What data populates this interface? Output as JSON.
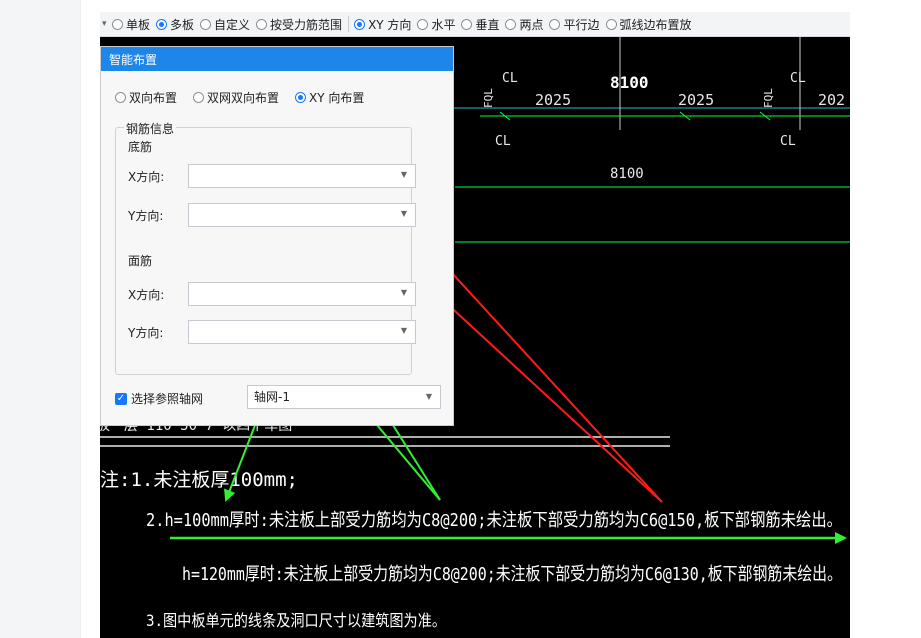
{
  "toolbar": {
    "options": [
      {
        "label": "单板",
        "checked": false
      },
      {
        "label": "多板",
        "checked": true
      },
      {
        "label": "自定义",
        "checked": false
      },
      {
        "label": "按受力筋范围",
        "checked": false
      },
      {
        "label": "XY 方向",
        "checked": true
      },
      {
        "label": "水平",
        "checked": false
      },
      {
        "label": "垂直",
        "checked": false
      },
      {
        "label": "两点",
        "checked": false
      },
      {
        "label": "平行边",
        "checked": false
      },
      {
        "label": "弧线边布置放",
        "checked": false
      }
    ]
  },
  "dialog": {
    "title": "智能布置",
    "modes": [
      {
        "label": "双向布置",
        "checked": false
      },
      {
        "label": "双网双向布置",
        "checked": false
      },
      {
        "label": "XY 向布置",
        "checked": true
      }
    ],
    "group_label": "钢筋信息",
    "bottom_label": "底筋",
    "top_label": "面筋",
    "x_label": "X方向:",
    "y_label": "Y方向:",
    "ref_checkbox_label": "选择参照轴网",
    "ref_checked": true,
    "ref_value": "轴网-1"
  },
  "cad": {
    "dim_8100": "8100",
    "dim_2025a": "2025",
    "dim_2025b": "2025",
    "dim_2025c": "202",
    "cl": "CL",
    "fql": "FQL",
    "notes_line1": "注:1.未注板厚100mm;",
    "notes_line2": "2.h=100mm厚时:未注板上部受力筋均为C8@200;未注板下部受力筋均为C6@150,板下部钢筋未绘出。",
    "notes_line3": "h=120mm厚时:未注板上部受力筋均为C8@200;未注板下部受力筋均为C6@130,板下部钢筋未绘出。",
    "notes_line4": "3.图中板单元的线条及洞口尺寸以建筑图为准。",
    "partial_heading": "板一层 110 50 7 以四干车图"
  },
  "colors": {
    "dialog_title_bg": "#1e86e8",
    "accent": "#1677ff",
    "cad_bg": "#000000",
    "cad_green": "#00ff44",
    "arrow_red": "#ff1a1a",
    "arrow_green": "#33ee33"
  }
}
